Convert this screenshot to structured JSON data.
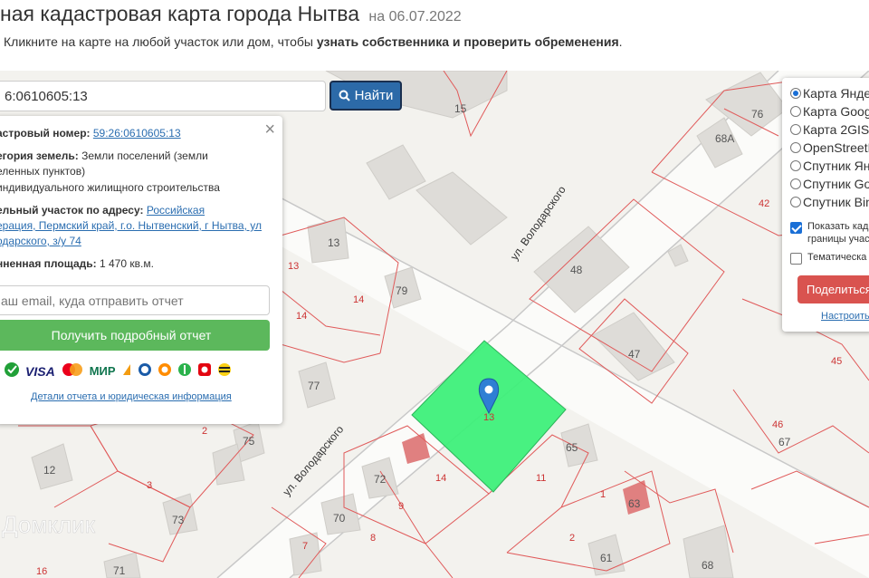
{
  "header": {
    "title": "ная кадастровая карта города Нытва",
    "date": "на 06.07.2022",
    "hint_prefix": "Кликните на карте на любой участок или дом, чтобы ",
    "hint_bold": "узнать собственника и проверить обременения",
    "hint_suffix": "."
  },
  "search": {
    "value": "6:0610605:13",
    "button_label": "Найти"
  },
  "info": {
    "cadastral_label": "астровый номер:",
    "cadastral_value": "59:26:0610605:13",
    "category_label": "егория земель:",
    "category_line1": "Земли поселений (земли",
    "category_line2": "еленных пунктов)",
    "category_line3": "индивидуального жилищного строительства",
    "address_label": "ельный участок по адресу:",
    "address_line1": "Российская",
    "address_line2": "ерация, Пермский край, г.о. Нытвенский, г Нытва, ул",
    "address_line3": "одарского, з/у 74",
    "area_label": "нненная площадь:",
    "area_value": "1 470 кв.м.",
    "email_placeholder": "аш email, куда отправить отчет",
    "report_button": "Получить подробный отчет",
    "details_link": "Детали отчета и юридическая информация",
    "payment_icons": [
      "sberbank-icon",
      "visa-icon",
      "mastercard-icon",
      "mir-icon",
      "yoomoney-icon",
      "webmoney-icon",
      "qiwi-icon",
      "sbp-icon",
      "mts-icon",
      "beeline-icon"
    ],
    "visa_text": "VISA",
    "mir_text": "МИР"
  },
  "layers": {
    "options": [
      "Карта Янде",
      "Карта Googl",
      "Карта 2GIS",
      "OpenStreetM",
      "Спутник Ян",
      "Спутник Go",
      "Спутник Bin"
    ],
    "selected_index": 0,
    "checkbox1_line1": "Показать кад",
    "checkbox1_line2": "границы учас",
    "checkbox1_checked": true,
    "checkbox2_label": "Тематическа",
    "checkbox2_checked": false,
    "share_button": "Поделиться",
    "configure_link": "Настроить"
  },
  "map": {
    "streets": [
      "ул. Володарского",
      "ул. Володарского"
    ],
    "house_numbers": [
      "15",
      "76",
      "68А",
      "13",
      "79",
      "48",
      "47",
      "77",
      "75",
      "12",
      "73",
      "70",
      "72",
      "65",
      "63",
      "61",
      "68",
      "71"
    ],
    "parcel_numbers": [
      "42",
      "14",
      "13",
      "14",
      "45",
      "46",
      "67",
      "2",
      "3",
      "8",
      "9",
      "14",
      "11",
      "1",
      "2",
      "7",
      "16"
    ],
    "selected_parcel": "13",
    "watermark": "Домклик",
    "colors": {
      "parcel_line": "#e05a5a",
      "selected_fill": "#3ef07a",
      "search_button": "#2c6aa8",
      "report_button": "#5cb85c",
      "share_button": "#d9534f",
      "marker": "#2f7fd4"
    }
  }
}
